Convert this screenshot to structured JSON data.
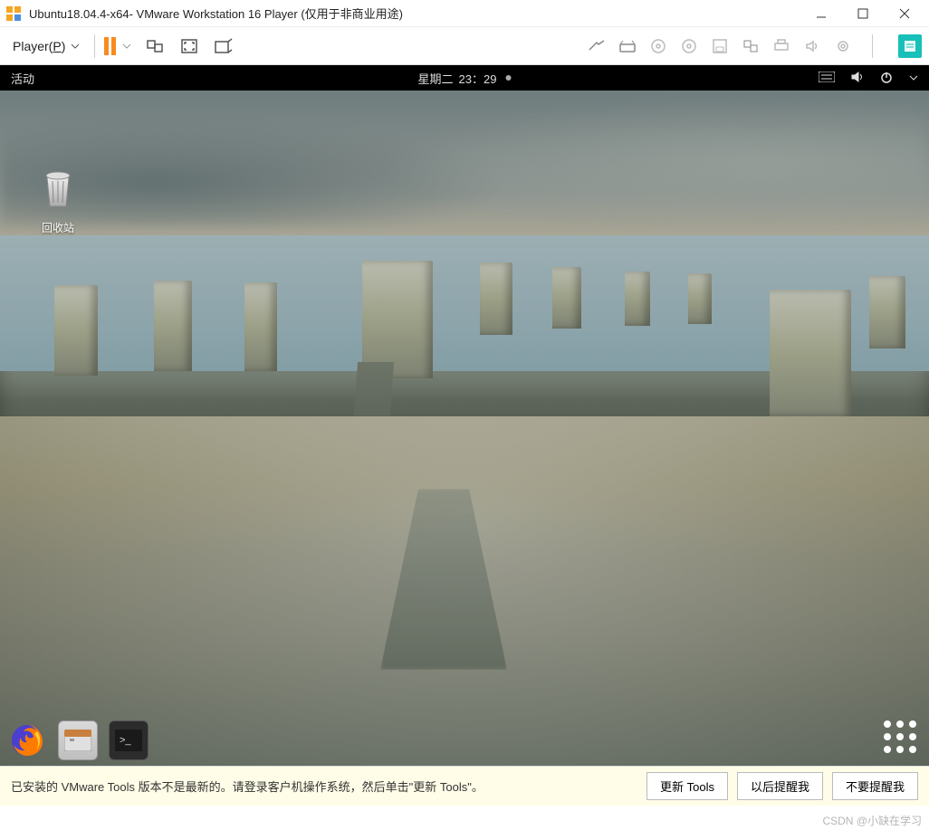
{
  "window": {
    "title": "Ubuntu18.04.4-x64- VMware Workstation 16 Player (仅用于非商业用途)"
  },
  "toolbar": {
    "player_menu_prefix": "Player(",
    "player_menu_hotkey": "P",
    "player_menu_suffix": ")"
  },
  "guest_topbar": {
    "activities": "活动",
    "day": "星期二",
    "time": "23：29"
  },
  "desktop": {
    "trash_label": "回收站"
  },
  "notification": {
    "message": "已安装的 VMware Tools 版本不是最新的。请登录客户机操作系统，然后单击\"更新 Tools\"。",
    "btn_update": "更新 Tools",
    "btn_later": "以后提醒我",
    "btn_never": "不要提醒我"
  },
  "watermark": "CSDN @小缺在学习"
}
